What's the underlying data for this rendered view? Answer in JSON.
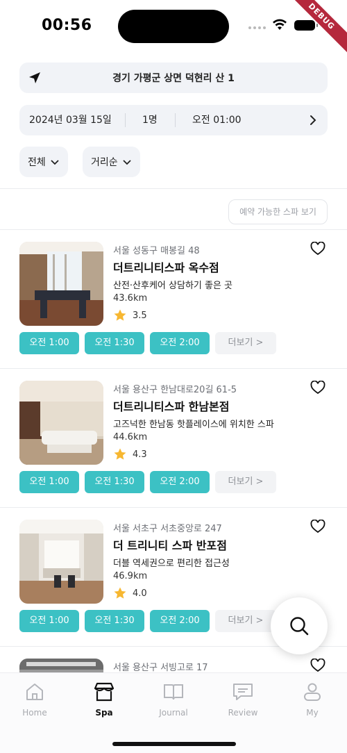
{
  "status": {
    "time": "00:56",
    "debug_label": "DEBUG"
  },
  "location": {
    "text": "경기 가평군 상면 덕현리 산 1"
  },
  "booking": {
    "date": "2024년 03월 15일",
    "people": "1명",
    "time": "오전 01:00"
  },
  "filters": {
    "category": "전체",
    "sort": "거리순"
  },
  "available_button": "예약 가능한 스파 보기",
  "spas": [
    {
      "address": "서울 성동구 매봉길 48",
      "name": "더트리니티스파 옥수점",
      "description": "산전·산후케어 상담하기 좋은 곳",
      "distance": "43.6km",
      "rating": "3.5",
      "slots": [
        "오전 1:00",
        "오전 1:30",
        "오전 2:00"
      ],
      "more": "더보기 >"
    },
    {
      "address": "서울 용산구 한남대로20길 61-5",
      "name": "더트리니티스파 한남본점",
      "description": "고즈넉한 한남동 핫플레이스에 위치한 스파",
      "distance": "44.6km",
      "rating": "4.3",
      "slots": [
        "오전 1:00",
        "오전 1:30",
        "오전 2:00"
      ],
      "more": "더보기 >"
    },
    {
      "address": "서울 서초구 서초중앙로 247",
      "name": "더 트리니티 스파 반포점",
      "description": "더블 역세권으로 편리한 접근성",
      "distance": "46.9km",
      "rating": "4.0",
      "slots": [
        "오전 1:00",
        "오전 1:30",
        "오전 2:00"
      ],
      "more": "더보기 >"
    },
    {
      "address": "서울 용산구 서빙고로 17"
    }
  ],
  "tabs": [
    {
      "label": "Home",
      "icon": "home-icon"
    },
    {
      "label": "Spa",
      "icon": "store-icon",
      "active": true
    },
    {
      "label": "Journal",
      "icon": "book-icon"
    },
    {
      "label": "Review",
      "icon": "chat-icon"
    },
    {
      "label": "My",
      "icon": "user-icon"
    }
  ],
  "colors": {
    "accent": "#3cc1c4",
    "star": "#f7b731",
    "chip_bg": "#f1f3f7"
  }
}
